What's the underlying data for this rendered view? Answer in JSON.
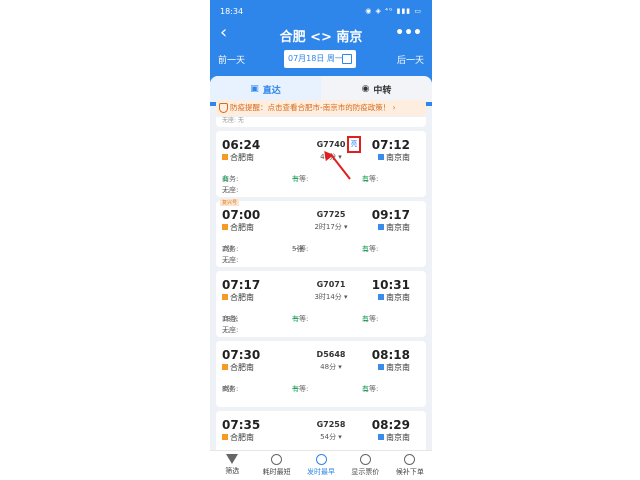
{
  "status_bar": {
    "time": "18:34",
    "icons": "◉ ◈ ⁴ᴳ ▮▮▮ ▭"
  },
  "header": {
    "back": "‹",
    "title": "合肥 <> 南京",
    "more": "•••",
    "prev_day": "前一天",
    "date": "07月18日 周一",
    "next_day": "后一天"
  },
  "tabs": [
    {
      "label": "直达"
    },
    {
      "label": "中转"
    }
  ],
  "notice": "防疫提醒：点击查看合肥市-南京市的防疫政策！ ›",
  "stub_text": "无座: 无",
  "trains": [
    {
      "dep": "06:24",
      "arr": "07:12",
      "train": "G7740",
      "dur": "48分 ▾",
      "from": "合肥南",
      "to": "南京南",
      "tag": "",
      "seats": {
        "business": "有",
        "first": "有",
        "second": "有",
        "none": "无"
      }
    },
    {
      "dep": "07:00",
      "arr": "09:17",
      "train": "G7725",
      "dur": "2时17分 ▾",
      "from": "合肥南",
      "to": "南京南",
      "tag": "复兴号",
      "seats": {
        "business": "2张",
        "first": "5张",
        "second": "有",
        "none": "无"
      }
    },
    {
      "dep": "07:17",
      "arr": "10:31",
      "train": "G7071",
      "dur": "3时14分 ▾",
      "from": "合肥南",
      "to": "南京南",
      "tag": "",
      "seats": {
        "business": "18张",
        "first": "有",
        "second": "有",
        "none": "无"
      }
    },
    {
      "dep": "07:30",
      "arr": "08:18",
      "train": "D5648",
      "dur": "48分 ▾",
      "from": "合肥南",
      "to": "南京南",
      "tag": "",
      "seats": {
        "business": "8张",
        "first": "有",
        "second": "有",
        "none": ""
      }
    },
    {
      "dep": "07:35",
      "arr": "08:29",
      "train": "G7258",
      "dur": "54分 ▾",
      "from": "合肥南",
      "to": "南京南",
      "tag": "",
      "seats": {
        "business": "",
        "first": "",
        "second": "",
        "none": ""
      }
    }
  ],
  "labels": {
    "business": "商务: ",
    "first": "一等: ",
    "second": "二等: ",
    "none": "无座: "
  },
  "highlight_badge": "亮",
  "bottom": [
    {
      "label": "筛选"
    },
    {
      "label": "耗时最短"
    },
    {
      "label": "发时最早"
    },
    {
      "label": "显示票价"
    },
    {
      "label": "候补下单"
    }
  ]
}
